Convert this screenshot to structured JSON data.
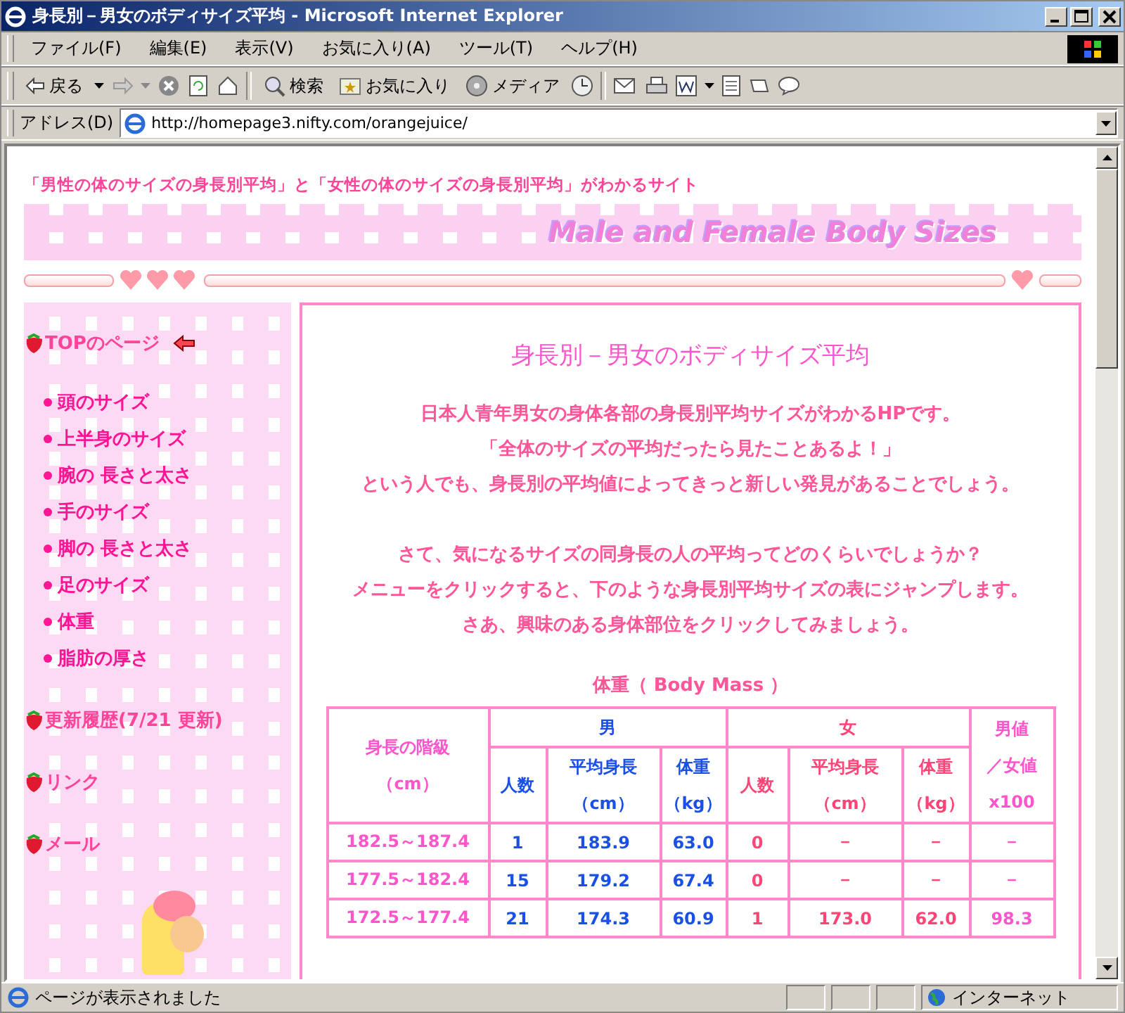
{
  "window": {
    "title": "身長別－男女のボディサイズ平均 - Microsoft Internet Explorer"
  },
  "menu": [
    "ファイル(F)",
    "編集(E)",
    "表示(V)",
    "お気に入り(A)",
    "ツール(T)",
    "ヘルプ(H)"
  ],
  "toolbar": {
    "back": "戻る",
    "search": "検索",
    "favorites": "お気に入り",
    "media": "メディア"
  },
  "address": {
    "label": "アドレス(D)",
    "url": "http://homepage3.nifty.com/orangejuice/"
  },
  "page": {
    "tagline": "「男性の体のサイズの身長別平均」と「女性の体のサイズの身長別平均」がわかるサイト",
    "banner_title": "Male and Female Body Sizes",
    "nav": {
      "top": "TOPのページ",
      "items": [
        "頭のサイズ",
        "上半身のサイズ",
        "腕の 長さと太さ",
        "手のサイズ",
        "脚の 長さと太さ",
        "足のサイズ",
        "体重",
        "脂肪の厚さ"
      ],
      "links": [
        "更新履歴(7/21 更新)",
        "リンク",
        "メール"
      ]
    },
    "heading": "身長別－男女のボディサイズ平均",
    "paragraphs": [
      [
        "日本人青年男女の身体各部の身長別平均サイズがわかるHPです。",
        "「全体のサイズの平均だったら見たことあるよ！」",
        "という人でも、身長別の平均値によってきっと新しい発見があることでしょう。"
      ],
      [
        "さて、気になるサイズの同身長の人の平均ってどのくらいでしょうか？",
        "メニューをクリックすると、下のような身長別平均サイズの表にジャンプします。",
        "さあ、興味のある身体部位をクリックしてみましょう。"
      ]
    ],
    "table_title": "体重（ Body Mass ）",
    "table": {
      "corner": [
        "身長の階級",
        "（cm）"
      ],
      "male": "男",
      "female": "女",
      "ratio": [
        "男値",
        "／女値",
        "x100"
      ],
      "sub": [
        [
          "人数"
        ],
        [
          "平均身長",
          "（cm）"
        ],
        [
          "体重",
          "（kg）"
        ],
        [
          "人数"
        ],
        [
          "平均身長",
          "（cm）"
        ],
        [
          "体重",
          "（kg）"
        ]
      ],
      "rows": [
        [
          "182.5～187.4",
          "1",
          "183.9",
          "63.0",
          "0",
          "－",
          "－",
          "－"
        ],
        [
          "177.5～182.4",
          "15",
          "179.2",
          "67.4",
          "0",
          "－",
          "－",
          "－"
        ],
        [
          "172.5～177.4",
          "21",
          "174.3",
          "60.9",
          "1",
          "173.0",
          "62.0",
          "98.3"
        ]
      ]
    }
  },
  "status_bar": {
    "text": "ページが表示されました",
    "zone": "インターネット"
  }
}
